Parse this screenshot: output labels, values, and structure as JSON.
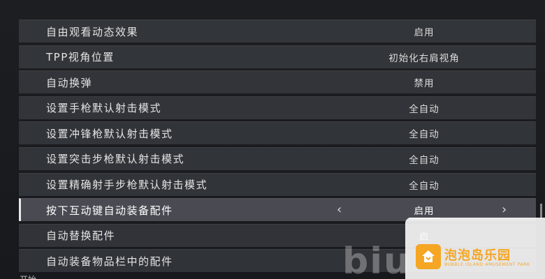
{
  "settings": {
    "items": [
      {
        "label": "自由观看动态效果",
        "value": "启用"
      },
      {
        "label": "TPP视角位置",
        "value": "初始化右肩视角"
      },
      {
        "label": "自动换弹",
        "value": "禁用"
      },
      {
        "label": "设置手枪默认射击模式",
        "value": "全自动"
      },
      {
        "label": "设置冲锋枪默认射击模式",
        "value": "全自动"
      },
      {
        "label": "设置突击步枪默认射击模式",
        "value": "全自动"
      },
      {
        "label": "设置精确射手步枪默认射击模式",
        "value": "全自动"
      },
      {
        "label": "按下互动键自动装备配件",
        "value": "启用"
      },
      {
        "label": "自动替换配件",
        "value": "启"
      },
      {
        "label": "自动装备物品栏中的配件",
        "value": ""
      }
    ],
    "selected_index": 7,
    "arrow_left": "‹",
    "arrow_right": "›"
  },
  "bottom_label": "开始",
  "watermark": {
    "text": "biu",
    "brand_cn": "泡泡岛乐园",
    "brand_en": "BUBBLE ISLAND AMUSEMENT PARK",
    "accent": "#f5a623"
  }
}
